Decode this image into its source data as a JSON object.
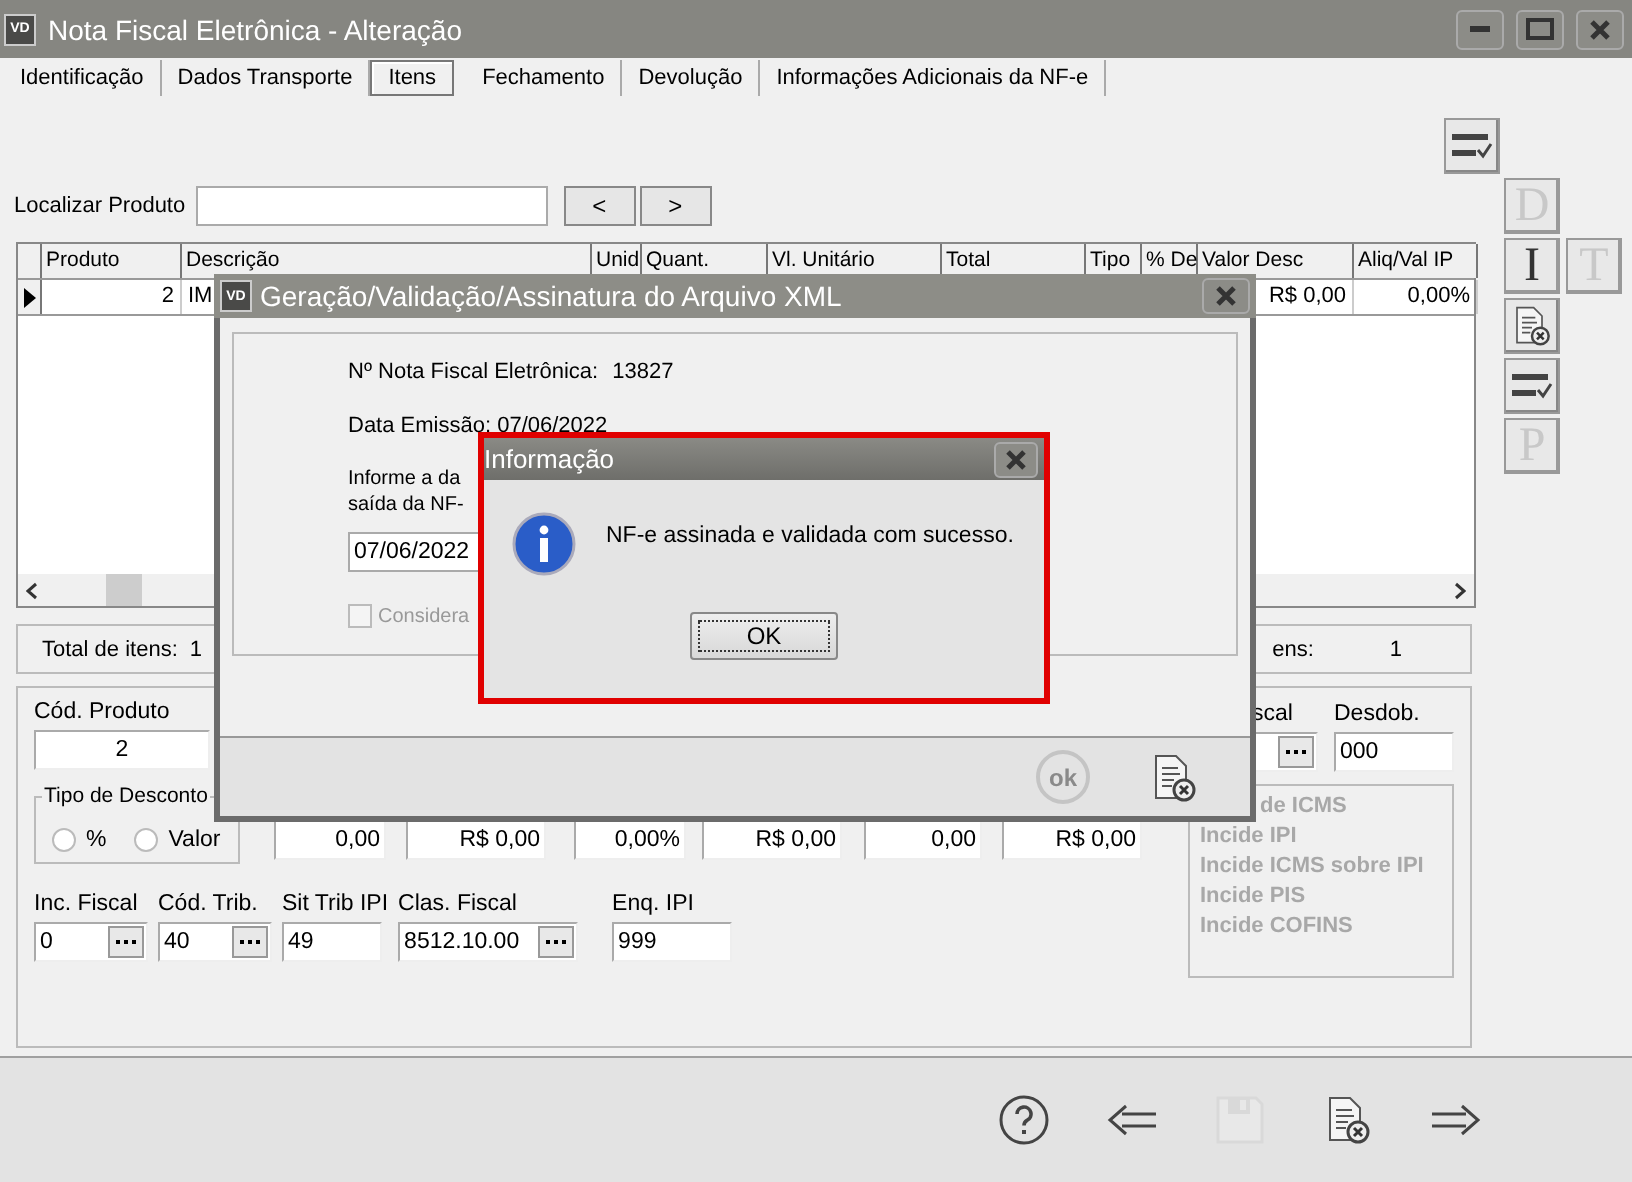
{
  "window": {
    "badge": "VD",
    "title": "Nota Fiscal Eletrônica - Alteração"
  },
  "tabs": [
    {
      "label": "Identificação",
      "selected": false
    },
    {
      "label": "Dados Transporte",
      "selected": false
    },
    {
      "label": "Itens",
      "selected": true
    },
    {
      "label": "Fechamento",
      "selected": false
    },
    {
      "label": "Devolução",
      "selected": false
    },
    {
      "label": "Informações Adicionais da NF-e",
      "selected": false
    }
  ],
  "search": {
    "label": "Localizar Produto",
    "buttons": [
      "<",
      ">"
    ]
  },
  "grid": {
    "columns": [
      "Produto",
      "Descrição",
      "Unid",
      "Quant.",
      "Vl. Unitário",
      "Total",
      "Tipo",
      "% De",
      "Valor Desc",
      "Aliq/Val IP"
    ],
    "rows": [
      {
        "current": true,
        "produto": "2",
        "descricao": "IM",
        "valor_desc": "R$ 0,00",
        "aliq_ipi": "0,00%"
      }
    ]
  },
  "side_buttons": [
    {
      "kind": "letter",
      "label": "D",
      "disabled": true
    },
    {
      "kind": "letter",
      "label": "I",
      "disabled": false
    },
    {
      "kind": "letter",
      "label": "T",
      "disabled": true
    },
    {
      "kind": "cancel",
      "disabled": false
    },
    {
      "kind": "checklist",
      "disabled": false
    },
    {
      "kind": "letter",
      "label": "P",
      "disabled": true
    }
  ],
  "totals": {
    "label": "Total de itens:",
    "value": "1",
    "right_label": "ens:",
    "right_value": "1"
  },
  "product_form": {
    "code_label": "Cód. Produto",
    "code": "2",
    "discount_type": {
      "label": "Tipo de Desconto",
      "options": [
        {
          "label": "%",
          "selected": false
        },
        {
          "label": "Valor",
          "selected": false
        }
      ]
    },
    "amounts": [
      "0,00",
      "R$ 0,00",
      "0,00%",
      "R$ 0,00",
      "0,00",
      "R$ 0,00"
    ],
    "fields": [
      {
        "label": "Inc. Fiscal",
        "value": "0",
        "lookup": true
      },
      {
        "label": "Cód. Trib.",
        "value": "40",
        "lookup": true
      },
      {
        "label": "Sit Trib IPI",
        "value": "49",
        "lookup": false
      },
      {
        "label": "Clas. Fiscal",
        "value": "8512.10.00",
        "lookup": true
      },
      {
        "label": "Enq. IPI",
        "value": "999",
        "lookup": false
      }
    ],
    "fiscal_label": "scal",
    "split_label": "Desdob.",
    "split": "000",
    "flags": [
      {
        "label": "de ICMS",
        "disabled": true
      },
      {
        "label": "Incide IPI",
        "disabled": true
      },
      {
        "label": "Incide ICMS sobre IPI",
        "disabled": true
      },
      {
        "label": "Incide PIS",
        "disabled": true
      },
      {
        "label": "Incide COFINS",
        "disabled": true
      }
    ]
  },
  "bottom_toolbar": [
    {
      "kind": "help",
      "disabled": false
    },
    {
      "kind": "back",
      "disabled": false
    },
    {
      "kind": "save",
      "disabled": true
    },
    {
      "kind": "cancel",
      "disabled": false
    },
    {
      "kind": "forward",
      "disabled": false
    }
  ],
  "xml_dialog": {
    "badge": "VD",
    "title": "Geração/Validação/Assinatura do Arquivo XML",
    "invoice_label": "Nº Nota Fiscal Eletrônica:",
    "invoice_number": "13827",
    "issue_date": "Data Emissão: 07/06/2022",
    "prompt": [
      "Informe a da",
      "saída da NF-"
    ],
    "exit_date": "07/06/2022",
    "option": {
      "label": "Considera",
      "checked": false,
      "disabled": true
    },
    "ok": {
      "label": "ok",
      "disabled": true
    }
  },
  "info_dialog": {
    "title": "Informação",
    "message": "NF-e assinada e validada com sucesso.",
    "button": "OK"
  }
}
